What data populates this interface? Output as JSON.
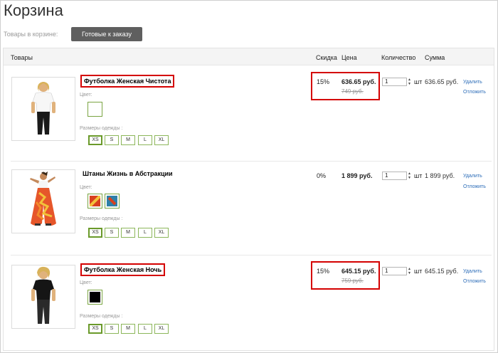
{
  "page": {
    "title": "Корзина"
  },
  "status": {
    "label": "Товары в корзине:",
    "ready_tab": "Готовые к заказу"
  },
  "table": {
    "headers": {
      "products": "Товары",
      "discount": "Скидка",
      "price": "Цена",
      "quantity": "Количество",
      "sum": "Сумма"
    },
    "color_label": "Цвет:",
    "size_label": "Размеры одежды :",
    "sizes": [
      "XS",
      "S",
      "M",
      "L",
      "XL"
    ],
    "unit": "шт",
    "delete_label": "Удалить",
    "postpone_label": "Отложить",
    "items": [
      {
        "name": "Футболка Женская Чистота",
        "discount": "15%",
        "price": "636.65 руб.",
        "old_price": "749 руб.",
        "quantity": "1",
        "sum": "636.65 руб.",
        "selected_size": "XS",
        "colors": [
          "#ffffff"
        ]
      },
      {
        "name": "Штаны Жизнь в Абстракции",
        "discount": "0%",
        "price": "1 899 руб.",
        "old_price": "",
        "quantity": "1",
        "sum": "1 899 руб.",
        "selected_size": "XS",
        "colors": [
          "#d8401e",
          "#2f7fa8"
        ]
      },
      {
        "name": "Футболка Женская Ночь",
        "discount": "15%",
        "price": "645.15 руб.",
        "old_price": "759 руб.",
        "quantity": "1",
        "sum": "645.15 руб.",
        "selected_size": "XS",
        "colors": [
          "#000000"
        ]
      }
    ]
  },
  "colors": {
    "highlight": "#d40000",
    "swatch_border": "#7aa442",
    "link": "#2b6cb8",
    "tab_bg": "#5f5f5f"
  }
}
